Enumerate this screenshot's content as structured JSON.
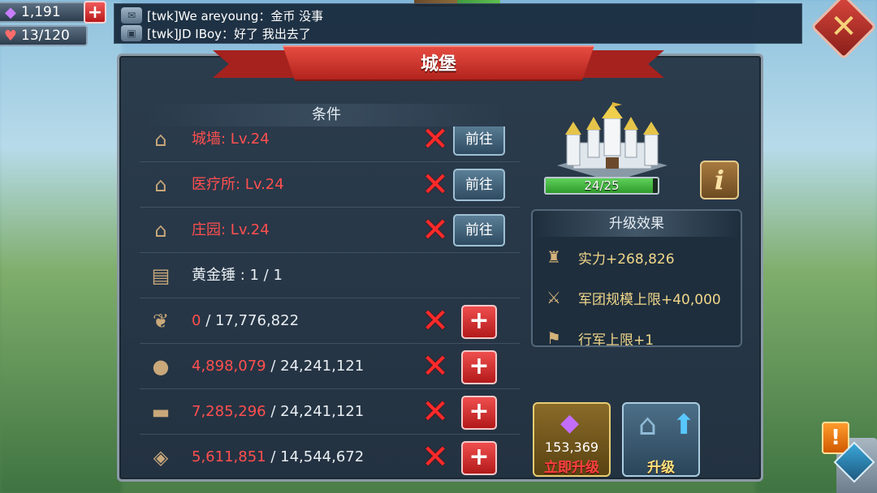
{
  "hud": {
    "gems": "1,191",
    "hearts": "13/120"
  },
  "chat": [
    {
      "text": "[twk]We areyoung：金币  没事"
    },
    {
      "text": "[twk]JD IBoy：好了  我出去了"
    }
  ],
  "panel": {
    "title": "城堡",
    "conditions_header": "条件",
    "go_label": "前往",
    "requirements": [
      {
        "icon": "building-icon",
        "label": "城墙: Lv.24",
        "met": false,
        "action": "go"
      },
      {
        "icon": "building-icon",
        "label": "医疗所: Lv.24",
        "met": false,
        "action": "go"
      },
      {
        "icon": "building-icon",
        "label": "庄园: Lv.24",
        "met": false,
        "action": "go"
      },
      {
        "icon": "scroll-icon",
        "label": "黄金锤 : 1 / 1",
        "met": true,
        "action": "none"
      }
    ],
    "resources": [
      {
        "icon": "wheat-icon",
        "current": "0",
        "required": "/ 17,776,822"
      },
      {
        "icon": "stone-icon",
        "current": "4,898,079",
        "required": "/ 24,241,121"
      },
      {
        "icon": "wood-icon",
        "current": "7,285,296",
        "required": "/ 24,241,121"
      },
      {
        "icon": "ore-icon",
        "current": "5,611,851",
        "required": "/ 14,544,672"
      }
    ]
  },
  "castle": {
    "level_text": "24/25",
    "progress": 0.96
  },
  "effects": {
    "title": "升级效果",
    "items": [
      {
        "icon": "power-icon",
        "text": "实力+268,826"
      },
      {
        "icon": "army-icon",
        "text": "军团规模上限+40,000"
      },
      {
        "icon": "march-icon",
        "text": "行军上限+1"
      }
    ]
  },
  "actions": {
    "instant_cost": "153,369",
    "instant_label": "立即升级",
    "upgrade_label": "升级"
  }
}
